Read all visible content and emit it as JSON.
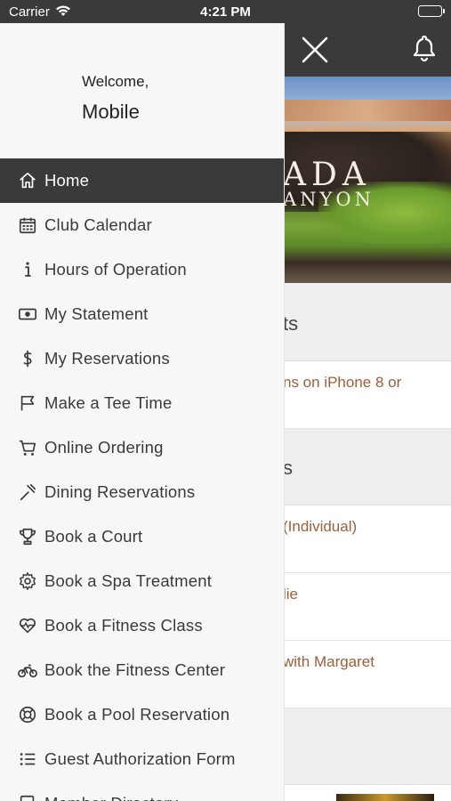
{
  "status_bar": {
    "carrier": "Carrier",
    "time": "4:21 PM"
  },
  "drawer": {
    "welcome": "Welcome,",
    "username": "Mobile",
    "items": [
      {
        "label": "Home",
        "icon": "home-icon",
        "active": true
      },
      {
        "label": "Club Calendar",
        "icon": "calendar-icon"
      },
      {
        "label": "Hours of Operation",
        "icon": "info-icon"
      },
      {
        "label": "My Statement",
        "icon": "money-bill-icon"
      },
      {
        "label": "My Reservations",
        "icon": "dollar-icon"
      },
      {
        "label": "Make a Tee Time",
        "icon": "flag-icon"
      },
      {
        "label": "Online Ordering",
        "icon": "cart-icon"
      },
      {
        "label": "Dining Reservations",
        "icon": "utensils-icon"
      },
      {
        "label": "Book a Court",
        "icon": "trophy-icon"
      },
      {
        "label": "Book a Spa Treatment",
        "icon": "gear-icon"
      },
      {
        "label": "Book a Fitness Class",
        "icon": "heartbeat-icon"
      },
      {
        "label": "Book the Fitness Center",
        "icon": "bicycle-icon"
      },
      {
        "label": "Book a Pool Reservation",
        "icon": "life-ring-icon"
      },
      {
        "label": "Guest Authorization Form",
        "icon": "list-icon"
      },
      {
        "label": "Member Directory",
        "icon": "directory-icon"
      }
    ]
  },
  "background_page": {
    "hero_text_line1": "ADA",
    "hero_text_line2": "ANYON",
    "section1_title": "ts",
    "row1": "ns on iPhone 8 or",
    "section2_title": "s",
    "row2": "(Individual)",
    "row3": "lie",
    "row4": "with Margaret"
  },
  "colors": {
    "header": "#3a3a3a",
    "drawer_bg": "#f7f7f7",
    "link": "#9c5f3a"
  }
}
